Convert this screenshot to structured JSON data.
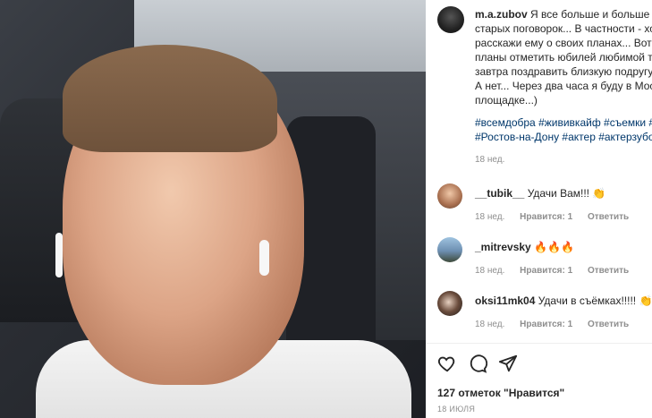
{
  "post": {
    "caption_username": "m.a.zubov",
    "caption_lines": [
      "Я все больше и больше уб",
      "старых поговорок... В частности - хоч",
      "расскажи ему о своих планах... Вот н",
      "планы отметить юбилей любимой тё",
      "завтра поздравить близкую подругу",
      "А нет... Через два часа я буду в Моск",
      "площадке...)"
    ],
    "hashtag_lines": [
      "#всемдобра #жививкайф #съемки #",
      "#Ростов-на-Дону #актер #актерзубо"
    ],
    "caption_time": "18 нед."
  },
  "comments": [
    {
      "username": "__tubik__",
      "text": "Удачи Вам!!! 👏",
      "time": "18 нед.",
      "likes": "Нравится: 1",
      "reply": "Ответить"
    },
    {
      "username": "_mitrevsky",
      "text": "🔥🔥🔥",
      "time": "18 нед.",
      "likes": "Нравится: 1",
      "reply": "Ответить"
    },
    {
      "username": "oksi11mk04",
      "text": "Удачи в съёмках!!!!! 👏👏",
      "time": "18 нед.",
      "likes": "Нравится: 1",
      "reply": "Ответить"
    }
  ],
  "footer": {
    "likes_text": "127 отметок \"Нравится\"",
    "date": "18 ИЮЛЯ"
  },
  "icons": [
    "heart-icon",
    "comment-icon",
    "share-icon"
  ],
  "colors": {
    "text": "#262626",
    "muted": "#8e8e8e",
    "hashtag": "#00376b",
    "divider": "#efefef"
  }
}
